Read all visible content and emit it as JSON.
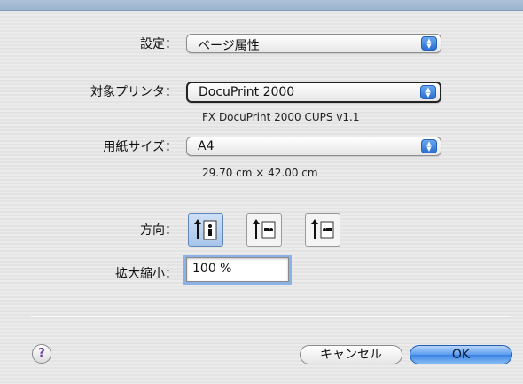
{
  "window": {
    "accent": "#9ab3cd"
  },
  "settings": {
    "label": "設定：",
    "value": "ページ属性"
  },
  "printer": {
    "label": "対象プリンタ：",
    "value": "DocuPrint 2000",
    "caption": "FX DocuPrint 2000 CUPS v1.1"
  },
  "paper": {
    "label": "用紙サイズ：",
    "value": "A4",
    "caption": "29.70 cm × 42.00 cm"
  },
  "orientation": {
    "label": "方向：",
    "options": [
      {
        "name": "portrait",
        "icon": "portrait-orientation-icon",
        "selected": true
      },
      {
        "name": "landscape",
        "icon": "landscape-orientation-icon",
        "selected": false
      },
      {
        "name": "reverse-landscape",
        "icon": "reverse-landscape-orientation-icon",
        "selected": false
      }
    ]
  },
  "scale": {
    "label": "拡大縮小：",
    "value": "100 %"
  },
  "footer": {
    "help_label": "?",
    "cancel_label": "キャンセル",
    "ok_label": "OK"
  }
}
